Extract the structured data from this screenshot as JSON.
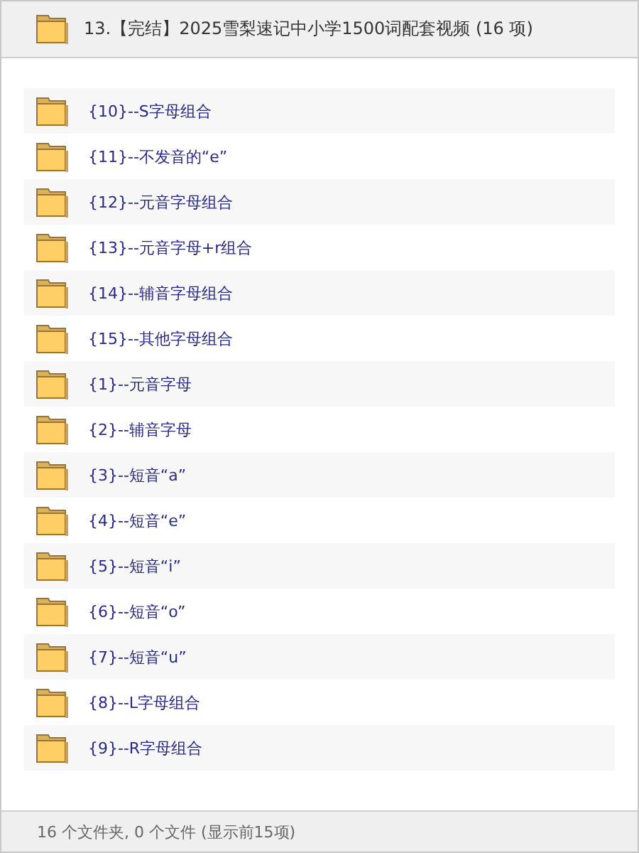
{
  "header": {
    "title": "13.【完结】2025雪梨速记中小学1500词配套视频 (16 项)"
  },
  "folders": [
    {
      "name": "{10}--S字母组合"
    },
    {
      "name": "{11}--不发音的“e”"
    },
    {
      "name": "{12}--元音字母组合"
    },
    {
      "name": "{13}--元音字母+r组合"
    },
    {
      "name": "{14}--辅音字母组合"
    },
    {
      "name": "{15}--其他字母组合"
    },
    {
      "name": "{1}--元音字母"
    },
    {
      "name": "{2}--辅音字母"
    },
    {
      "name": "{3}--短音“a”"
    },
    {
      "name": "{4}--短音“e”"
    },
    {
      "name": "{5}--短音“i”"
    },
    {
      "name": "{6}--短音“o”"
    },
    {
      "name": "{7}--短音“u”"
    },
    {
      "name": "{8}--L字母组合"
    },
    {
      "name": "{9}--R字母组合"
    }
  ],
  "status_bar": {
    "text": "16 个文件夹, 0 个文件 (显示前15项)"
  }
}
